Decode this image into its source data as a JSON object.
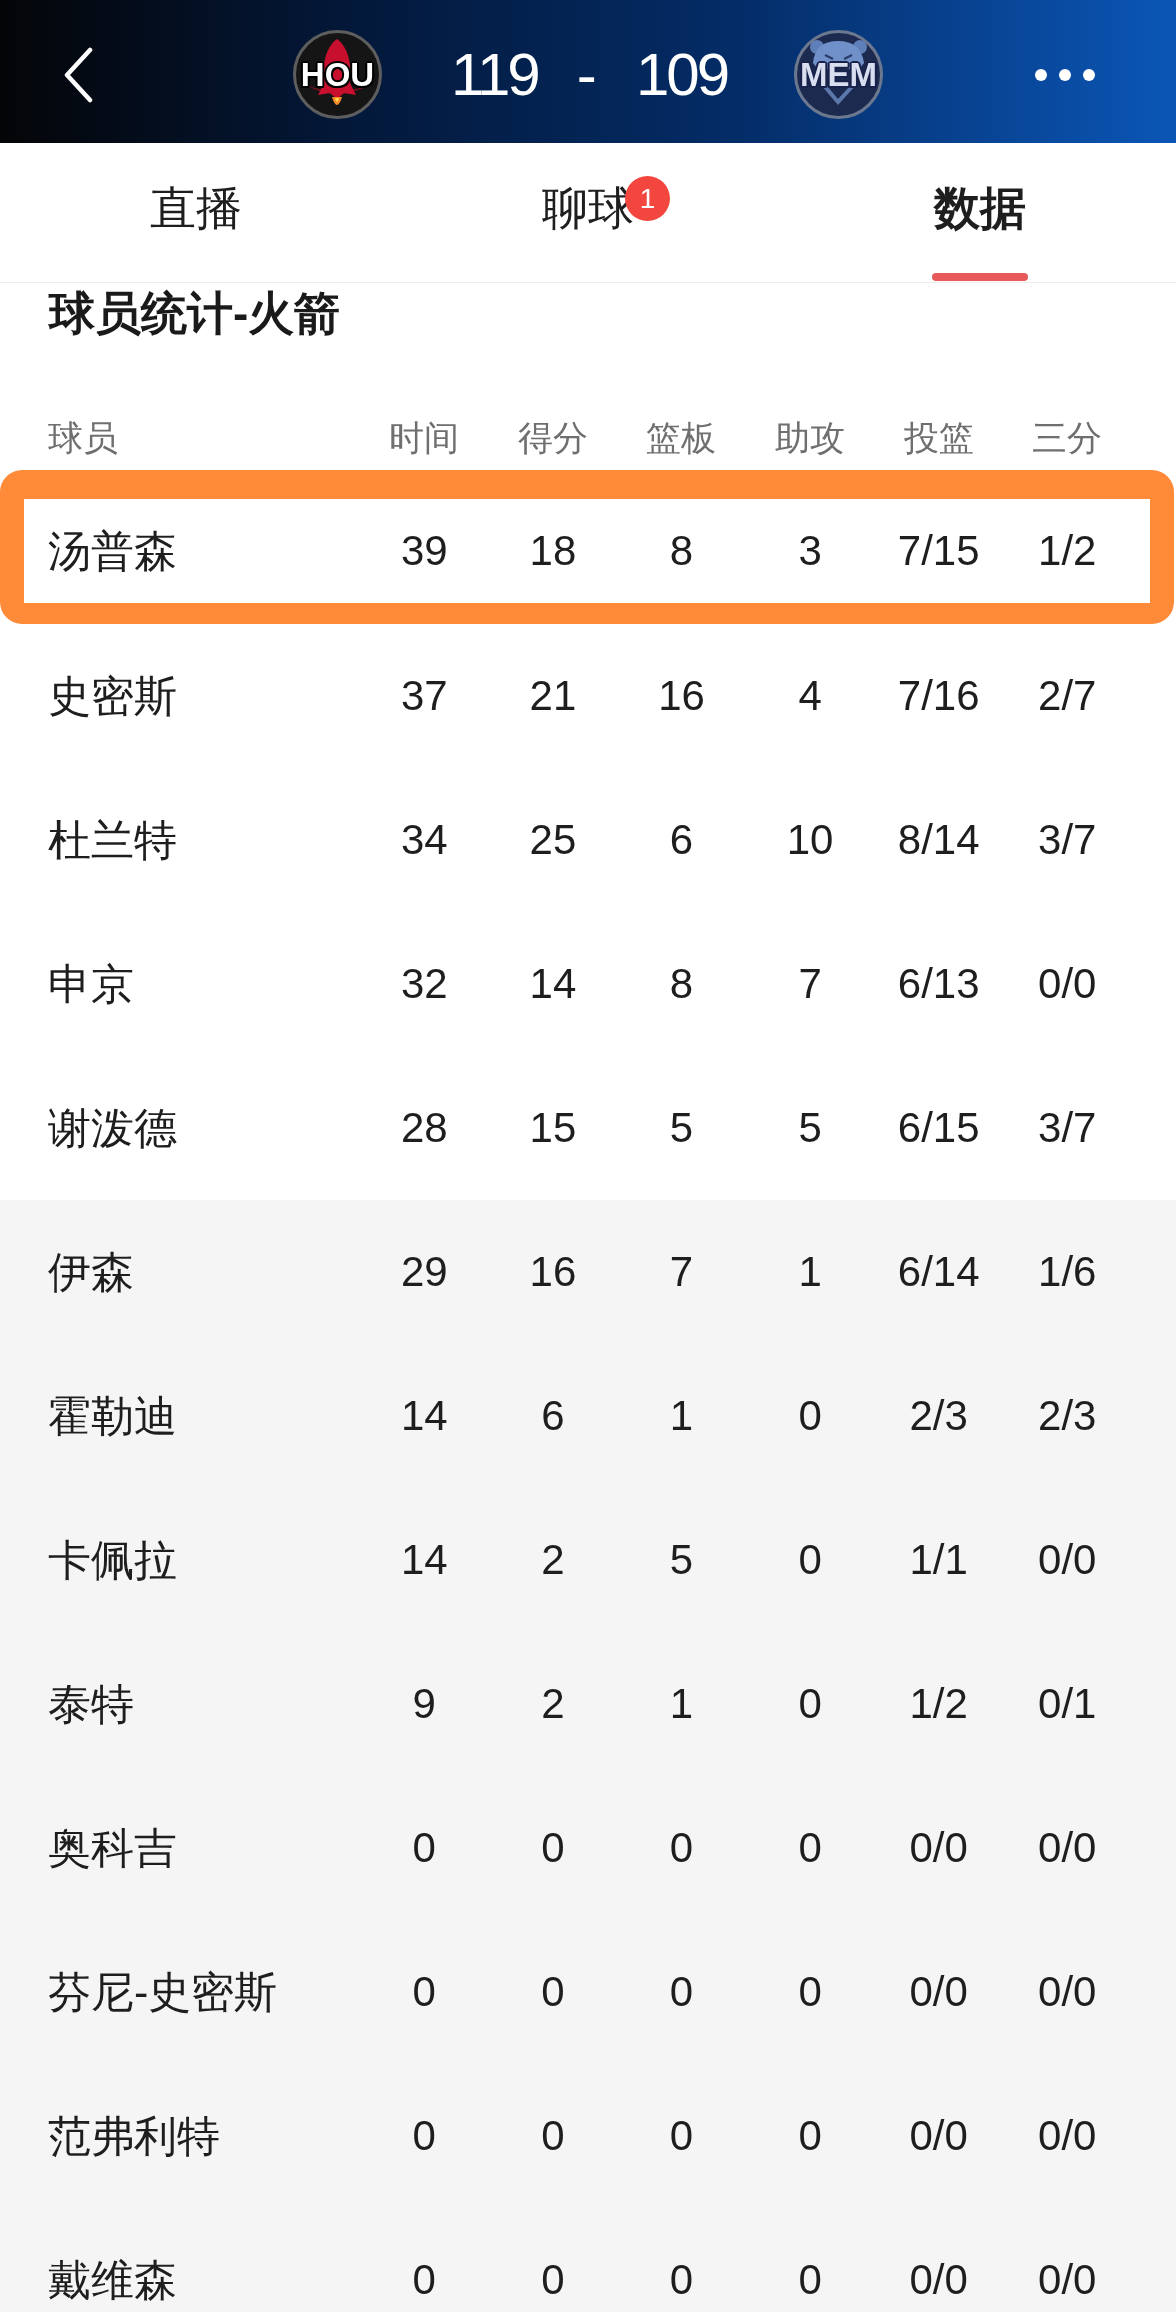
{
  "header": {
    "home_team": {
      "abbr": "HOU"
    },
    "home_score": "119",
    "separator": "-",
    "away_score": "109",
    "away_team": {
      "abbr": "MEM"
    }
  },
  "tabs": [
    {
      "label": "直播",
      "selected": false
    },
    {
      "label": "聊球",
      "selected": false,
      "badge": "1"
    },
    {
      "label": "数据",
      "selected": true
    }
  ],
  "section_title": "球员统计-火箭",
  "table": {
    "columns": [
      "球员",
      "时间",
      "得分",
      "篮板",
      "助攻",
      "投篮",
      "三分"
    ],
    "groups": [
      {
        "kind": "starters",
        "rows": [
          {
            "cells": [
              "汤普森",
              "39",
              "18",
              "8",
              "3",
              "7/15",
              "1/2"
            ],
            "highlighted": true
          },
          {
            "cells": [
              "史密斯",
              "37",
              "21",
              "16",
              "4",
              "7/16",
              "2/7"
            ],
            "highlighted": false
          },
          {
            "cells": [
              "杜兰特",
              "34",
              "25",
              "6",
              "10",
              "8/14",
              "3/7"
            ],
            "highlighted": false
          },
          {
            "cells": [
              "申京",
              "32",
              "14",
              "8",
              "7",
              "6/13",
              "0/0"
            ],
            "highlighted": false
          },
          {
            "cells": [
              "谢泼德",
              "28",
              "15",
              "5",
              "5",
              "6/15",
              "3/7"
            ],
            "highlighted": false
          }
        ]
      },
      {
        "kind": "bench",
        "rows": [
          {
            "cells": [
              "伊森",
              "29",
              "16",
              "7",
              "1",
              "6/14",
              "1/6"
            ],
            "highlighted": false
          },
          {
            "cells": [
              "霍勒迪",
              "14",
              "6",
              "1",
              "0",
              "2/3",
              "2/3"
            ],
            "highlighted": false
          },
          {
            "cells": [
              "卡佩拉",
              "14",
              "2",
              "5",
              "0",
              "1/1",
              "0/0"
            ],
            "highlighted": false
          },
          {
            "cells": [
              "泰特",
              "9",
              "2",
              "1",
              "0",
              "1/2",
              "0/1"
            ],
            "highlighted": false
          },
          {
            "cells": [
              "奥科吉",
              "0",
              "0",
              "0",
              "0",
              "0/0",
              "0/0"
            ],
            "highlighted": false
          },
          {
            "cells": [
              "芬尼-史密斯",
              "0",
              "0",
              "0",
              "0",
              "0/0",
              "0/0"
            ],
            "highlighted": false
          },
          {
            "cells": [
              "范弗利特",
              "0",
              "0",
              "0",
              "0",
              "0/0",
              "0/0"
            ],
            "highlighted": false
          },
          {
            "cells": [
              "戴维森",
              "0",
              "0",
              "0",
              "0",
              "0/0",
              "0/0"
            ],
            "highlighted": false
          }
        ]
      }
    ]
  }
}
